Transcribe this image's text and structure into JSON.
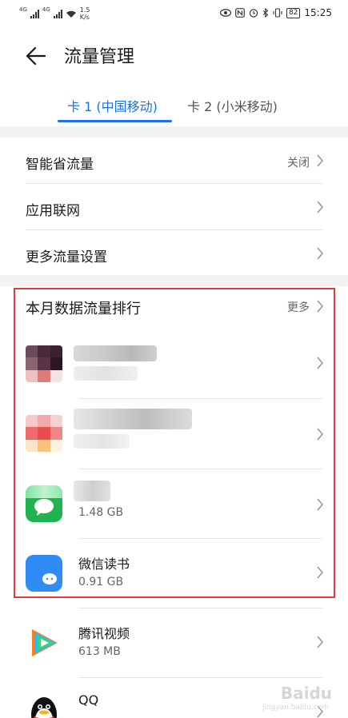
{
  "status_bar": {
    "network1": "4G",
    "network2": "4G",
    "speed_value": "1.5",
    "speed_unit": "K/s",
    "battery": "82",
    "time": "15:25"
  },
  "header": {
    "title": "流量管理"
  },
  "tabs": [
    {
      "label": "卡 1 (中国移动)"
    },
    {
      "label": "卡 2 (小米移动)"
    }
  ],
  "settings": [
    {
      "label": "智能省流量",
      "value": "关闭"
    },
    {
      "label": "应用联网",
      "value": ""
    },
    {
      "label": "更多流量设置",
      "value": ""
    }
  ],
  "ranking": {
    "title": "本月数据流量排行",
    "more": "更多",
    "apps": [
      {
        "name": "",
        "size": "",
        "icon": "pixelated-app-icon"
      },
      {
        "name": "",
        "size": "",
        "icon": "pixelated-app-icon"
      },
      {
        "name": "",
        "size": "1.48 GB",
        "icon": "green-app-icon"
      },
      {
        "name": "微信读书",
        "size": "0.91 GB",
        "icon": "weread-icon"
      },
      {
        "name": "腾讯视频",
        "size": "613 MB",
        "icon": "tencent-video-icon"
      },
      {
        "name": "QQ",
        "size": "",
        "icon": "qq-penguin-icon"
      }
    ]
  },
  "colors": {
    "accent": "#1a73e8",
    "highlight_box": "#e53935"
  },
  "watermark": {
    "text": "Baidu",
    "sub": "jingyan.baidu.com"
  }
}
